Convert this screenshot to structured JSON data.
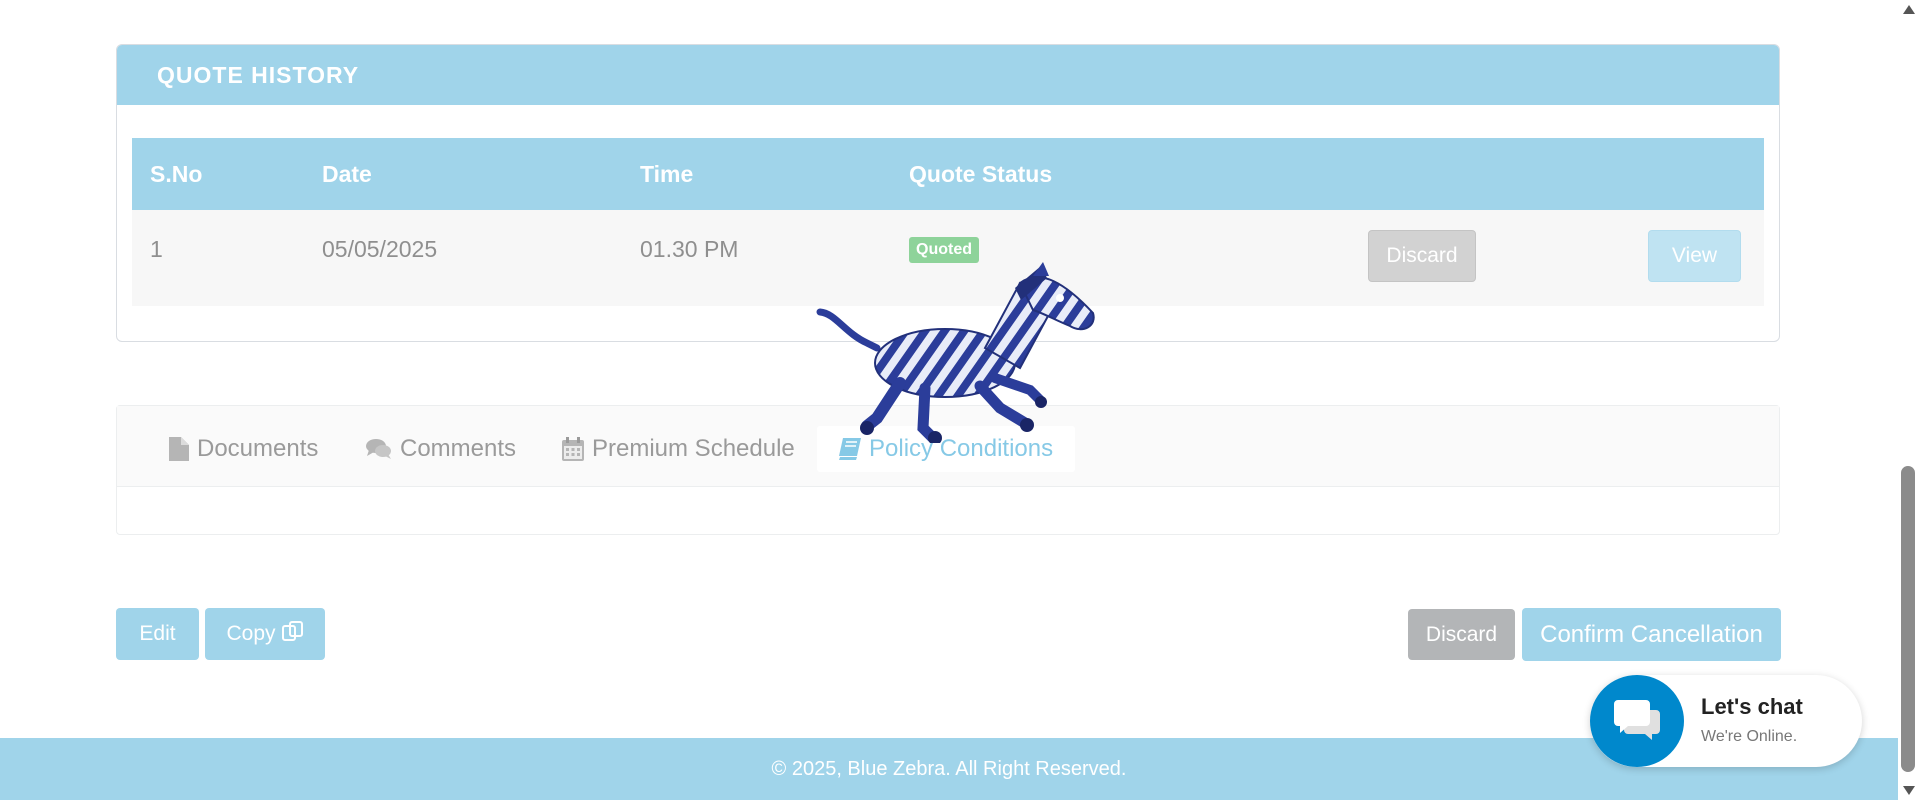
{
  "quote_history": {
    "title": "QUOTE HISTORY",
    "columns": [
      "S.No",
      "Date",
      "Time",
      "Quote Status"
    ],
    "rows": [
      {
        "sno": "1",
        "date": "05/05/2025",
        "time": "01.30 PM",
        "status": "Quoted",
        "discard_label": "Discard",
        "view_label": "View"
      }
    ]
  },
  "tabs": [
    {
      "label": "Documents",
      "icon": "file-icon"
    },
    {
      "label": "Comments",
      "icon": "comments-icon"
    },
    {
      "label": "Premium Schedule",
      "icon": "calendar-icon"
    },
    {
      "label": "Policy Conditions",
      "icon": "book-icon",
      "active": true
    }
  ],
  "actions": {
    "edit_label": "Edit",
    "copy_label": "Copy",
    "discard_label": "Discard",
    "confirm_label": "Confirm Cancellation"
  },
  "chat": {
    "title": "Let's chat",
    "subtitle": "We're Online."
  },
  "footer": {
    "text": "© 2025, Blue Zebra. All Right Reserved."
  },
  "colors": {
    "accent": "#a0d4ea",
    "chat_blue": "#0088cc",
    "status_green": "#8ed39a",
    "muted_grey": "#b3b5b7"
  }
}
